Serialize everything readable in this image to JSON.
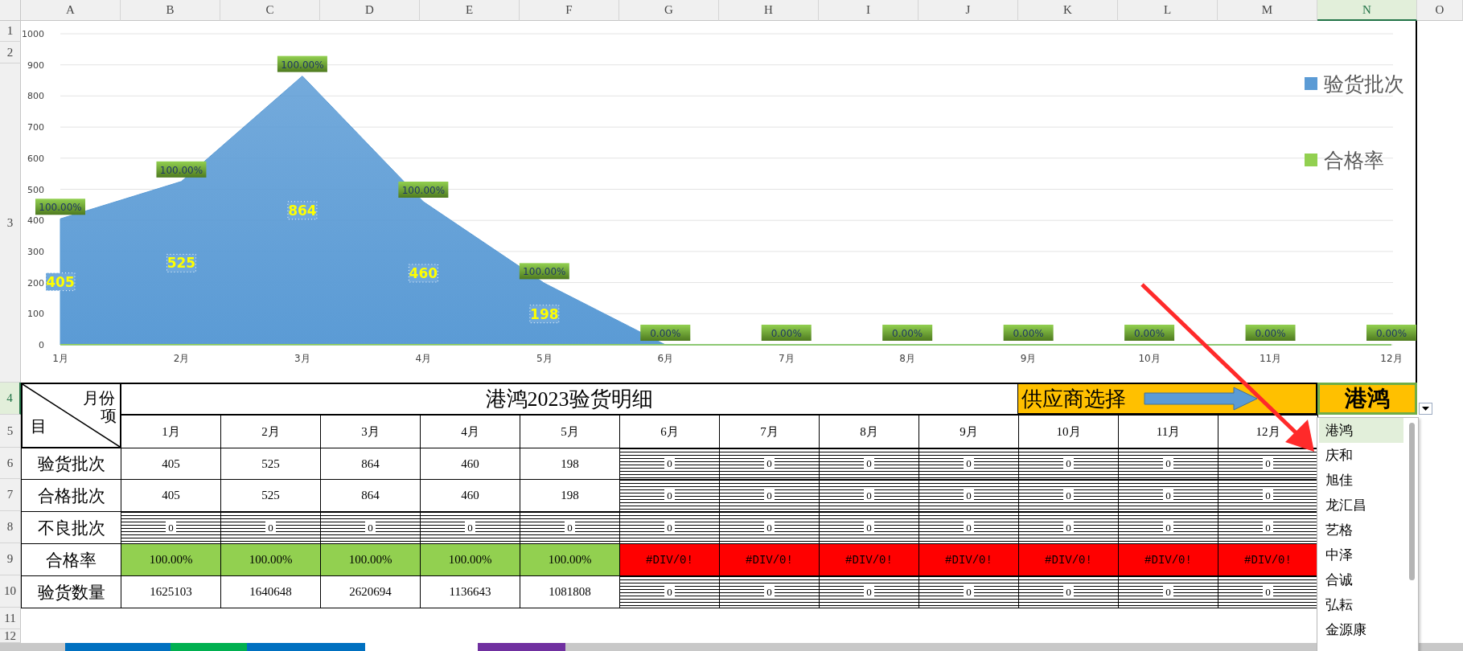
{
  "column_headers": [
    {
      "label": "A",
      "selected": false
    },
    {
      "label": "B",
      "selected": false
    },
    {
      "label": "C",
      "selected": false
    },
    {
      "label": "D",
      "selected": false
    },
    {
      "label": "E",
      "selected": false
    },
    {
      "label": "F",
      "selected": false
    },
    {
      "label": "G",
      "selected": false
    },
    {
      "label": "H",
      "selected": false
    },
    {
      "label": "I",
      "selected": false
    },
    {
      "label": "J",
      "selected": false
    },
    {
      "label": "K",
      "selected": false
    },
    {
      "label": "L",
      "selected": false
    },
    {
      "label": "M",
      "selected": false
    },
    {
      "label": "N",
      "selected": true
    },
    {
      "label": "O",
      "selected": false
    }
  ],
  "row_headers": [
    {
      "label": "1",
      "selected": false
    },
    {
      "label": "2",
      "selected": false
    },
    {
      "label": "3",
      "selected": false
    },
    {
      "label": "4",
      "selected": true
    },
    {
      "label": "5",
      "selected": false
    },
    {
      "label": "6",
      "selected": false
    },
    {
      "label": "7",
      "selected": false
    },
    {
      "label": "8",
      "selected": false
    },
    {
      "label": "9",
      "selected": false
    },
    {
      "label": "10",
      "selected": false
    },
    {
      "label": "11",
      "selected": false
    },
    {
      "label": "12",
      "selected": false
    }
  ],
  "chart": {
    "chart_data": {
      "type": "area",
      "categories": [
        "1月",
        "2月",
        "3月",
        "4月",
        "5月",
        "6月",
        "7月",
        "8月",
        "9月",
        "10月",
        "11月",
        "12月"
      ],
      "series": [
        {
          "name": "验货批次",
          "color": "#5b9bd5",
          "values": [
            405,
            525,
            864,
            460,
            198,
            0,
            0,
            0,
            0,
            0,
            0,
            0
          ]
        },
        {
          "name": "合格率",
          "color": "#92d050",
          "values": [
            1,
            1,
            1,
            1,
            1,
            0,
            0,
            0,
            0,
            0,
            0,
            0
          ]
        }
      ],
      "grid": true,
      "legend": true,
      "ylim": [
        0,
        1000
      ],
      "yticks": [
        0,
        100,
        200,
        300,
        400,
        500,
        600,
        700,
        800,
        900,
        1000
      ],
      "value_labels": [
        [
          "405",
          "525",
          "864",
          "460",
          "198",
          null,
          null,
          null,
          null,
          null,
          null,
          null
        ],
        [
          "100.00%",
          "100.00%",
          "100.00%",
          "100.00%",
          "100.00%",
          "0.00%",
          "0.00%",
          "0.00%",
          "0.00%",
          "0.00%",
          "0.00%",
          "0.00%"
        ]
      ]
    }
  },
  "table": {
    "corner": {
      "top": "月份",
      "middle": "项",
      "bottom": "目"
    },
    "title": "港鸿2023验货明细",
    "supplier_label": "供应商选择",
    "supplier_value": "港鸿",
    "months": [
      "1月",
      "2月",
      "3月",
      "4月",
      "5月",
      "6月",
      "7月",
      "8月",
      "9月",
      "10月",
      "11月",
      "12月"
    ],
    "rows": [
      {
        "label": "验货批次",
        "cells": [
          {
            "text": "405",
            "kind": "plain"
          },
          {
            "text": "525",
            "kind": "plain"
          },
          {
            "text": "864",
            "kind": "plain"
          },
          {
            "text": "460",
            "kind": "plain"
          },
          {
            "text": "198",
            "kind": "plain"
          },
          {
            "text": "0",
            "kind": "hatched"
          },
          {
            "text": "0",
            "kind": "hatched"
          },
          {
            "text": "0",
            "kind": "hatched"
          },
          {
            "text": "0",
            "kind": "hatched"
          },
          {
            "text": "0",
            "kind": "hatched"
          },
          {
            "text": "0",
            "kind": "hatched"
          },
          {
            "text": "0",
            "kind": "hatched"
          }
        ]
      },
      {
        "label": "合格批次",
        "cells": [
          {
            "text": "405",
            "kind": "plain"
          },
          {
            "text": "525",
            "kind": "plain"
          },
          {
            "text": "864",
            "kind": "plain"
          },
          {
            "text": "460",
            "kind": "plain"
          },
          {
            "text": "198",
            "kind": "plain"
          },
          {
            "text": "0",
            "kind": "hatched"
          },
          {
            "text": "0",
            "kind": "hatched"
          },
          {
            "text": "0",
            "kind": "hatched"
          },
          {
            "text": "0",
            "kind": "hatched"
          },
          {
            "text": "0",
            "kind": "hatched"
          },
          {
            "text": "0",
            "kind": "hatched"
          },
          {
            "text": "0",
            "kind": "hatched"
          }
        ]
      },
      {
        "label": "不良批次",
        "cells": [
          {
            "text": "0",
            "kind": "hatched"
          },
          {
            "text": "0",
            "kind": "hatched"
          },
          {
            "text": "0",
            "kind": "hatched"
          },
          {
            "text": "0",
            "kind": "hatched"
          },
          {
            "text": "0",
            "kind": "hatched"
          },
          {
            "text": "0",
            "kind": "hatched"
          },
          {
            "text": "0",
            "kind": "hatched"
          },
          {
            "text": "0",
            "kind": "hatched"
          },
          {
            "text": "0",
            "kind": "hatched"
          },
          {
            "text": "0",
            "kind": "hatched"
          },
          {
            "text": "0",
            "kind": "hatched"
          },
          {
            "text": "0",
            "kind": "hatched"
          }
        ]
      },
      {
        "label": "合格率",
        "cells": [
          {
            "text": "100.00%",
            "kind": "pass"
          },
          {
            "text": "100.00%",
            "kind": "pass"
          },
          {
            "text": "100.00%",
            "kind": "pass"
          },
          {
            "text": "100.00%",
            "kind": "pass"
          },
          {
            "text": "100.00%",
            "kind": "pass"
          },
          {
            "text": "#DIV/0!",
            "kind": "error"
          },
          {
            "text": "#DIV/0!",
            "kind": "error"
          },
          {
            "text": "#DIV/0!",
            "kind": "error"
          },
          {
            "text": "#DIV/0!",
            "kind": "error"
          },
          {
            "text": "#DIV/0!",
            "kind": "error"
          },
          {
            "text": "#DIV/0!",
            "kind": "error"
          },
          {
            "text": "#DIV/0!",
            "kind": "error"
          }
        ]
      },
      {
        "label": "验货数量",
        "cells": [
          {
            "text": "1625103",
            "kind": "plain"
          },
          {
            "text": "1640648",
            "kind": "plain"
          },
          {
            "text": "2620694",
            "kind": "plain"
          },
          {
            "text": "1136643",
            "kind": "plain"
          },
          {
            "text": "1081808",
            "kind": "plain"
          },
          {
            "text": "0",
            "kind": "hatched"
          },
          {
            "text": "0",
            "kind": "hatched"
          },
          {
            "text": "0",
            "kind": "hatched"
          },
          {
            "text": "0",
            "kind": "hatched"
          },
          {
            "text": "0",
            "kind": "hatched"
          },
          {
            "text": "0",
            "kind": "hatched"
          },
          {
            "text": "0",
            "kind": "hatched"
          }
        ]
      }
    ]
  },
  "dropdown": {
    "items": [
      {
        "label": "港鸿",
        "selected": true
      },
      {
        "label": "庆和",
        "selected": false
      },
      {
        "label": "旭佳",
        "selected": false
      },
      {
        "label": "龙汇昌",
        "selected": false
      },
      {
        "label": "艺格",
        "selected": false
      },
      {
        "label": "中泽",
        "selected": false
      },
      {
        "label": "合诚",
        "selected": false
      },
      {
        "label": "弘耘",
        "selected": false
      },
      {
        "label": "金源康",
        "selected": false
      }
    ]
  },
  "sheet_tabs": [
    {
      "color": "#0070c0"
    },
    {
      "color": "#00b050"
    },
    {
      "color": "#0070c0"
    },
    {
      "color": "#ffffff"
    },
    {
      "color": "#7030a0"
    }
  ]
}
